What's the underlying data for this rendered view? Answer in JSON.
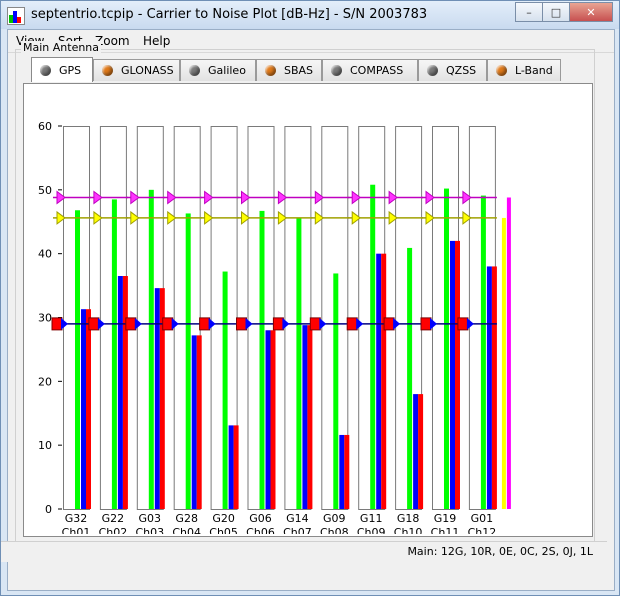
{
  "window": {
    "title": "septentrio.tcpip - Carrier to Noise Plot [dB-Hz] - S/N 2003783"
  },
  "menu": [
    "View",
    "Sort",
    "Zoom",
    "Help"
  ],
  "group": {
    "label": "Main Antenna"
  },
  "tabs": [
    {
      "label": "GPS",
      "color": "#7a7a7a"
    },
    {
      "label": "GLONASS",
      "color": "#e07a1a"
    },
    {
      "label": "Galileo",
      "color": "#7a7a7a"
    },
    {
      "label": "SBAS",
      "color": "#e07a1a"
    },
    {
      "label": "COMPASS",
      "color": "#7a7a7a"
    },
    {
      "label": "QZSS",
      "color": "#7a7a7a"
    },
    {
      "label": "L-Band",
      "color": "#e07a1a"
    }
  ],
  "status": {
    "text": "Main: 12G, 10R, 0E, 0C, 2S, 0J, 1L"
  },
  "chart_data": {
    "type": "bar",
    "ylim": [
      0,
      60
    ],
    "yticks": [
      0,
      10,
      20,
      30,
      40,
      50,
      60
    ],
    "categories": [
      {
        "sat": "G32",
        "ch": "Ch01"
      },
      {
        "sat": "G22",
        "ch": "Ch02"
      },
      {
        "sat": "G03",
        "ch": "Ch03"
      },
      {
        "sat": "G28",
        "ch": "Ch04"
      },
      {
        "sat": "G20",
        "ch": "Ch05"
      },
      {
        "sat": "G06",
        "ch": "Ch06"
      },
      {
        "sat": "G14",
        "ch": "Ch07"
      },
      {
        "sat": "G09",
        "ch": "Ch08"
      },
      {
        "sat": "G11",
        "ch": "Ch09"
      },
      {
        "sat": "G18",
        "ch": "Ch10"
      },
      {
        "sat": "G19",
        "ch": "Ch11"
      },
      {
        "sat": "G01",
        "ch": "Ch12"
      }
    ],
    "series": [
      {
        "color": "#00ff00",
        "values": [
          46.8,
          48.5,
          50.0,
          46.3,
          37.2,
          46.7,
          45.6,
          36.9,
          50.8,
          40.9,
          50.2,
          49.1
        ]
      },
      {
        "color": "#0000ff",
        "values": [
          31.3,
          36.5,
          34.6,
          27.2,
          13.1,
          28.0,
          28.8,
          11.6,
          40.0,
          18.0,
          42.0,
          38.0
        ]
      },
      {
        "color": "#ff0000",
        "values": [
          31.3,
          36.5,
          34.6,
          27.2,
          13.1,
          28.0,
          28.8,
          11.6,
          40.0,
          18.0,
          42.0,
          38.0
        ]
      },
      {
        "color": "#ffff00",
        "values": [
          0,
          0,
          0,
          0,
          0,
          0,
          0,
          0,
          0,
          0,
          0,
          45.6
        ]
      },
      {
        "color": "#ff00ff",
        "values": [
          0,
          0,
          0,
          0,
          0,
          0,
          0,
          0,
          0,
          0,
          0,
          48.8
        ]
      }
    ],
    "reference_lines": [
      {
        "value": 48.8,
        "color": "#c000c0",
        "marker_color": "#ff33ff"
      },
      {
        "value": 45.6,
        "color": "#a0a000",
        "marker_color": "#ffff00"
      },
      {
        "value": 29.0,
        "color": "#000080",
        "marker_color": "#0000ff",
        "marker_left": "#ff0000"
      }
    ],
    "grid": false,
    "legend": "none"
  }
}
